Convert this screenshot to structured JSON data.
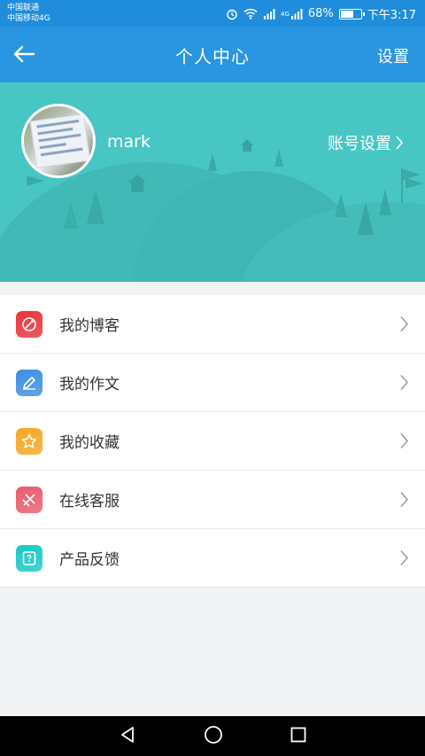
{
  "status_bar": {
    "carrier1": "中国联通",
    "carrier2": "中国移动4G",
    "network_tag": "4G",
    "battery_text": "68%",
    "battery_level": 0.68,
    "time": "下午3:17"
  },
  "nav": {
    "title": "个人中心",
    "settings_label": "设置"
  },
  "profile": {
    "username": "mark",
    "account_settings_label": "账号设置"
  },
  "menu": {
    "items": [
      {
        "label": "我的博客",
        "icon": "blog-icon",
        "color": "#e8333a"
      },
      {
        "label": "我的作文",
        "icon": "essay-pen-icon",
        "color": "#3a8fe0"
      },
      {
        "label": "我的收藏",
        "icon": "star-icon",
        "color": "#f5a623"
      },
      {
        "label": "在线客服",
        "icon": "customer-service-icon",
        "color": "#e85a6a"
      },
      {
        "label": "产品反馈",
        "icon": "feedback-icon",
        "color": "#17c8c4"
      }
    ]
  },
  "colors": {
    "status_bar": "#1f8ddb",
    "nav_bar": "#2a95e0",
    "banner": "#48c6c4"
  }
}
